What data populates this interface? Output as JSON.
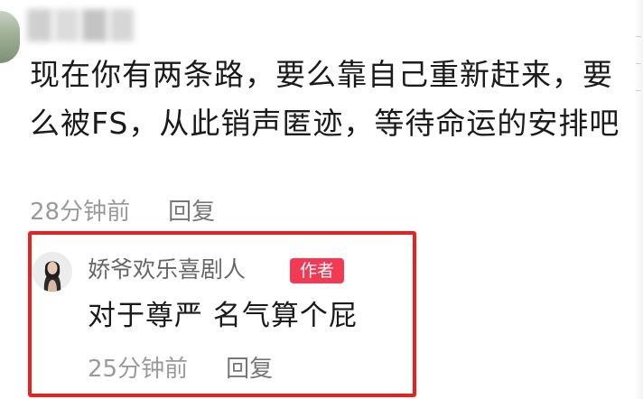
{
  "comment": {
    "text": "现在你有两条路，要么靠自己重新赶来，要么被FS，从此销声匿迹，等待命运的安排吧",
    "time": "28分钟前",
    "reply_label": "回复"
  },
  "author_reply": {
    "username": "娇爷欢乐喜剧人",
    "badge": "作者",
    "text": "对于尊严 名气算个屁",
    "time": "25分钟前",
    "reply_label": "回复"
  },
  "colors": {
    "highlight_border": "#e8211f",
    "badge_bg": "#f23a55",
    "meta_text": "#9a9a9a"
  }
}
